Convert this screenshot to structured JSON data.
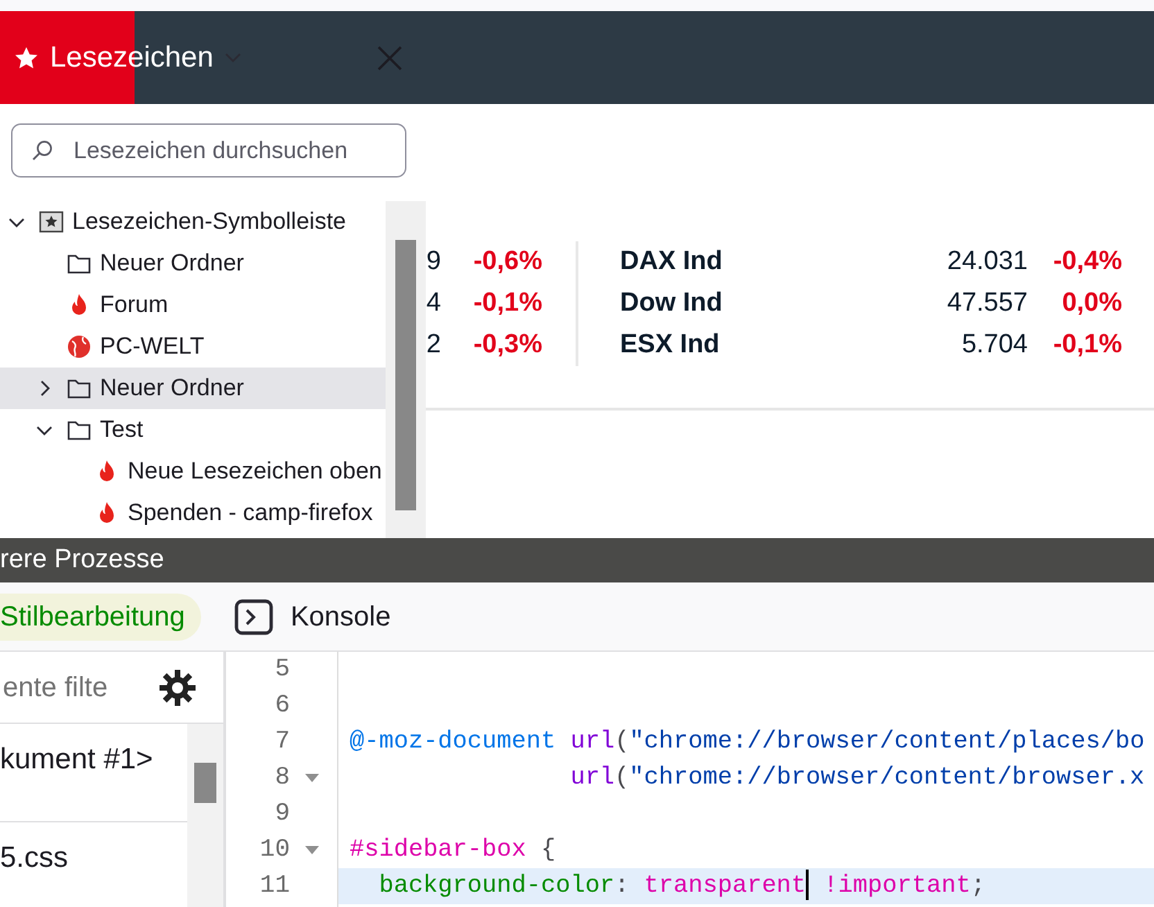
{
  "sidebar": {
    "title": "Lesezeichen",
    "search": {
      "placeholder": "Lesezeichen durchsuchen"
    },
    "tree": [
      {
        "label": "Lesezeichen-Symbolleiste",
        "kind": "toolbar",
        "expanded": true,
        "selected": false,
        "children": [
          {
            "label": "Neuer Ordner",
            "kind": "folder",
            "selected": false
          },
          {
            "label": "Forum",
            "kind": "flame",
            "selected": false
          },
          {
            "label": "PC-WELT",
            "kind": "globe",
            "selected": false
          },
          {
            "label": "Neuer Ordner",
            "kind": "folder",
            "expanded": false,
            "selected": true
          },
          {
            "label": "Test",
            "kind": "folder",
            "expanded": true,
            "selected": false,
            "children": [
              {
                "label": "Neue Lesezeichen oben",
                "kind": "flame",
                "selected": false
              },
              {
                "label": "Spenden - camp-firefox",
                "kind": "flame",
                "selected": false
              }
            ]
          }
        ]
      }
    ]
  },
  "markets": {
    "left": [
      {
        "value": "9",
        "change": "-0,6%"
      },
      {
        "value": "4",
        "change": "-0,1%"
      },
      {
        "value": "2",
        "change": "-0,3%"
      }
    ],
    "right": [
      {
        "name": "DAX Ind",
        "value": "24.031",
        "change": "-0,4%"
      },
      {
        "name": "Dow Ind",
        "value": "47.557",
        "change": "0,0%"
      },
      {
        "name": "ESX Ind",
        "value": "5.704",
        "change": "-0,1%"
      }
    ]
  },
  "devtools": {
    "title": "rere Prozesse",
    "tabs": [
      {
        "label": "Stilbearbeitung",
        "kind": "style",
        "selected": true
      },
      {
        "label": "Konsole",
        "kind": "console",
        "selected": false
      }
    ],
    "filter": {
      "placeholder": "ente filte"
    },
    "files": [
      "kument #1>",
      "5.css"
    ],
    "lines": [
      {
        "number": "5",
        "foldable": false,
        "active": false
      },
      {
        "number": "6",
        "foldable": false,
        "active": false
      },
      {
        "number": "7",
        "kind": "rule",
        "foldable": false,
        "active": false,
        "tokens": [
          {
            "kind": "at-rule",
            "text": "@-moz-document "
          },
          {
            "kind": "function",
            "text": "url"
          },
          {
            "kind": "punct",
            "text": "("
          },
          {
            "kind": "string",
            "text": "\"chrome://browser/content/places/bo"
          }
        ]
      },
      {
        "number": "8",
        "kind": "continuation",
        "foldable": true,
        "active": false,
        "tokens": [
          {
            "kind": "function",
            "text": "url"
          },
          {
            "kind": "punct",
            "text": "("
          },
          {
            "kind": "string",
            "text": "\"chrome://browser/content/browser.x"
          }
        ]
      },
      {
        "number": "9",
        "foldable": false,
        "active": false
      },
      {
        "number": "10",
        "kind": "rule",
        "foldable": true,
        "active": false,
        "tokens": [
          {
            "kind": "selector",
            "text": "#sidebar-box"
          },
          {
            "kind": "punct",
            "text": " {"
          }
        ]
      },
      {
        "number": "11",
        "kind": "declaration",
        "foldable": false,
        "active": true,
        "tokens": [
          {
            "kind": "property",
            "text": "background-color"
          },
          {
            "kind": "punct",
            "text": ": "
          },
          {
            "kind": "value",
            "text": "transparent",
            "caret_after": true
          },
          {
            "kind": "value",
            "text": " !important"
          },
          {
            "kind": "punct",
            "text": ";"
          }
        ]
      }
    ]
  }
}
